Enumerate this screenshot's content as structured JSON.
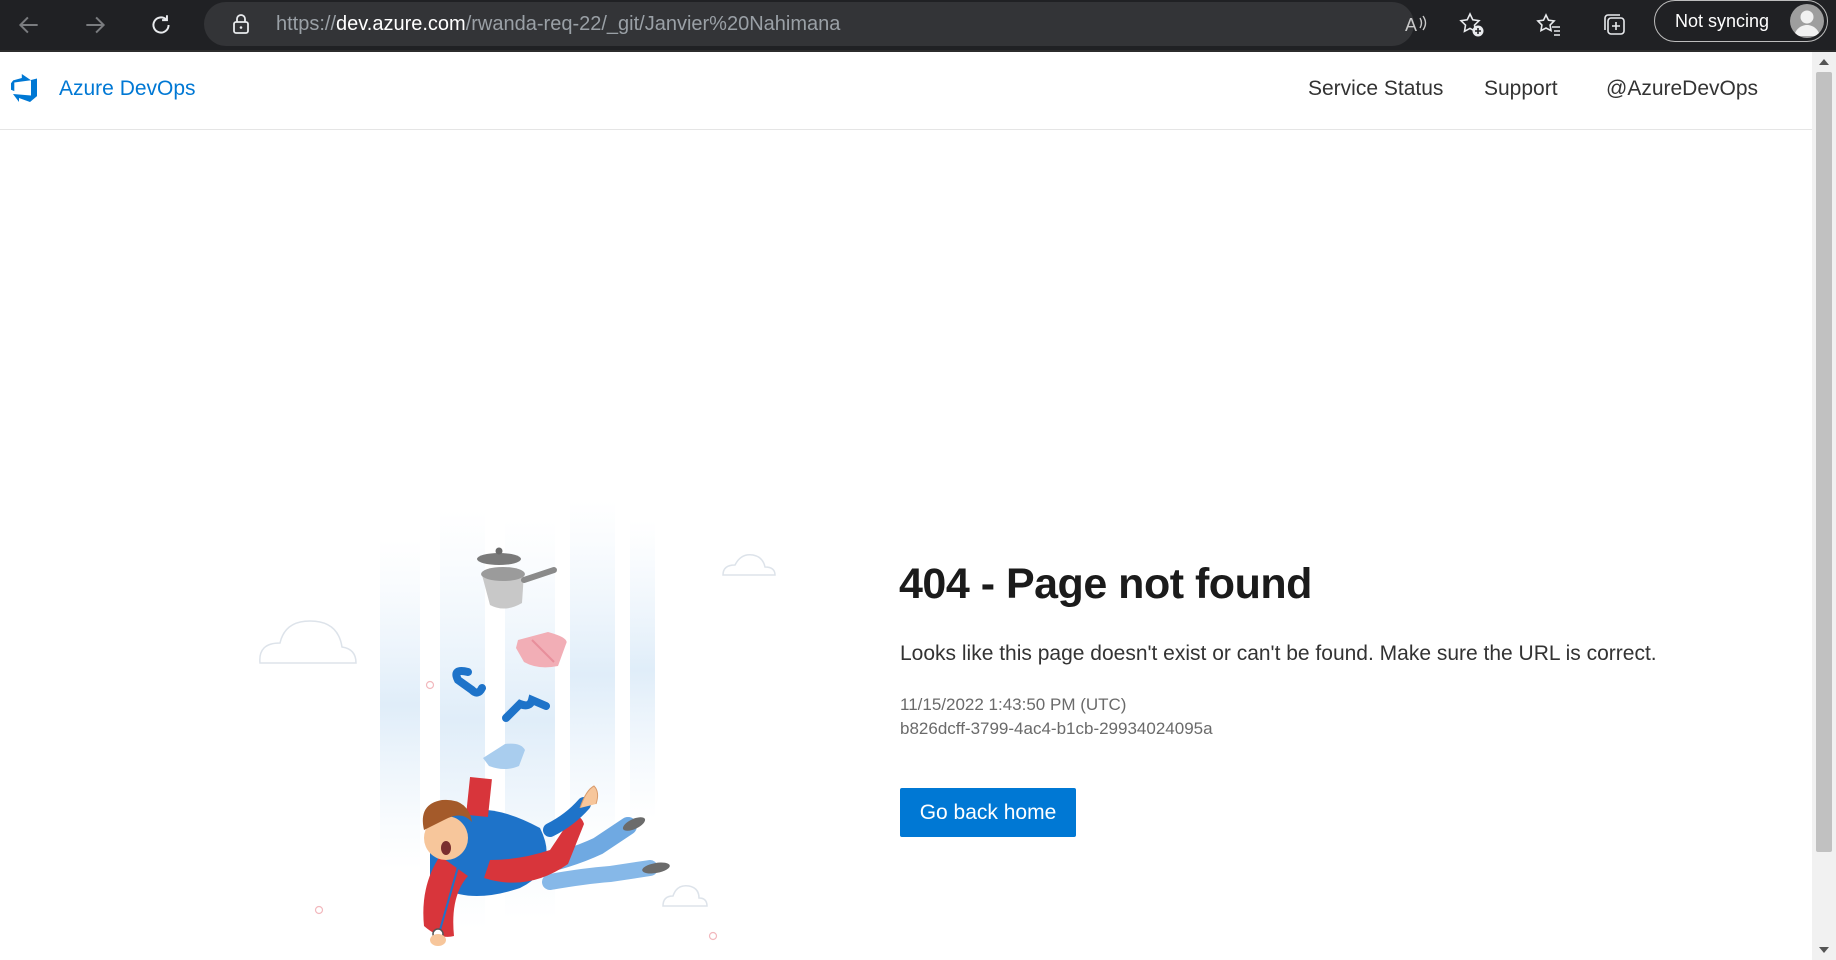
{
  "browser": {
    "url_scheme": "https://",
    "url_domain": "dev.azure.com",
    "url_path": "/rwanda-req-22/_git/Janvier%20Nahimana",
    "sync_label": "Not syncing"
  },
  "header": {
    "brand": "Azure DevOps",
    "links": [
      "Service Status",
      "Support",
      "@AzureDevOps"
    ]
  },
  "main": {
    "title": "404 - Page not found",
    "description": "Looks like this page doesn't exist or can't be found. Make sure the URL is correct.",
    "timestamp": "11/15/2022 1:43:50 PM (UTC)",
    "activity_id": "b826dcff-3799-4ac4-b1cb-29934024095a",
    "button_label": "Go back home"
  },
  "colors": {
    "accent": "#0078d4",
    "browser_bg": "#202124",
    "title": "#1b1b1b"
  },
  "icons": [
    "back-arrow-icon",
    "forward-arrow-icon",
    "refresh-icon",
    "lock-icon",
    "read-aloud-icon",
    "add-favorite-icon",
    "favorites-icon",
    "collections-icon",
    "profile-avatar-icon",
    "azure-devops-logo"
  ]
}
